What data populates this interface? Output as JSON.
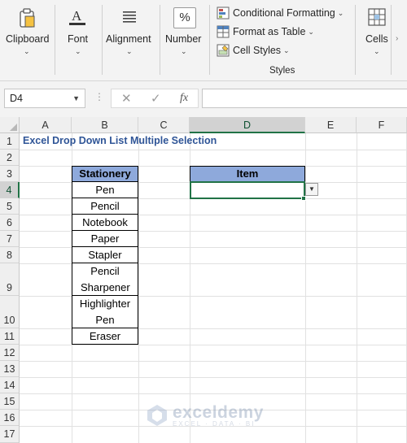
{
  "ribbon": {
    "clipboard": {
      "label": "Clipboard",
      "caret": "⌄"
    },
    "font": {
      "label": "Font",
      "caret": "⌄"
    },
    "alignment": {
      "label": "Alignment",
      "caret": "⌄"
    },
    "number": {
      "label": "Number",
      "caret": "⌄",
      "icon_glyph": "%"
    },
    "styles": {
      "conditional_formatting": "Conditional Formatting",
      "format_as_table": "Format as Table",
      "cell_styles": "Cell Styles",
      "group_label": "Styles"
    },
    "cells": {
      "label": "Cells",
      "caret": "⌄"
    },
    "scroll_glyph": "›"
  },
  "formula_bar": {
    "name_box": "D4",
    "cancel_glyph": "✕",
    "enter_glyph": "✓",
    "fx_glyph": "fx",
    "formula": ""
  },
  "sheet": {
    "columns": [
      "A",
      "B",
      "C",
      "D",
      "E",
      "F"
    ],
    "selected_column": "D",
    "rows": [
      "1",
      "2",
      "3",
      "4",
      "5",
      "6",
      "7",
      "8",
      "9",
      "10",
      "11",
      "12",
      "13",
      "14",
      "15",
      "16",
      "17"
    ],
    "selected_row": "4",
    "title": "Excel Drop Down List Multiple Selection",
    "stationery_header": "Stationery",
    "stationery_items": [
      "Pen",
      "Pencil",
      "Notebook",
      "Paper",
      "Stapler",
      "Pencil Sharpener",
      "Highlighter Pen",
      "Eraser"
    ],
    "item_header": "Item",
    "item_value": "",
    "dropdown_glyph": "▼"
  },
  "watermark": {
    "name": "exceldemy",
    "tagline": "EXCEL · DATA · BI"
  },
  "colors": {
    "accent": "#217346",
    "table_header": "#8ea9db",
    "title_text": "#2f5597"
  }
}
